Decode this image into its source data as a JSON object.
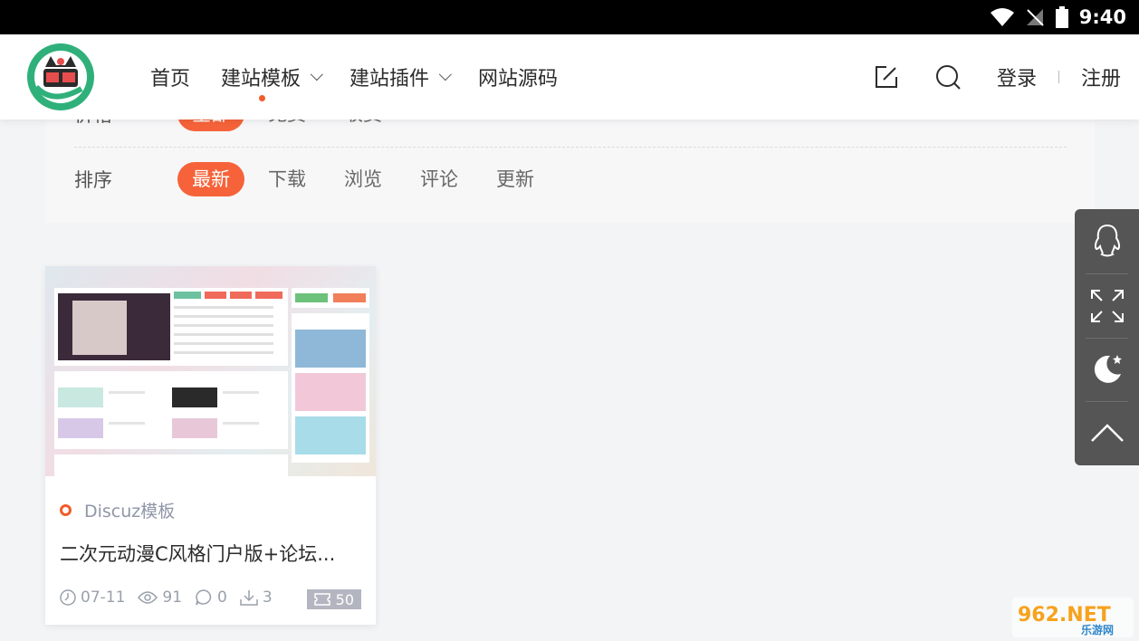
{
  "status_bar": {
    "time": "9:40"
  },
  "nav": {
    "items": [
      {
        "label": "首页"
      },
      {
        "label": "建站模板"
      },
      {
        "label": "建站插件"
      },
      {
        "label": "网站源码"
      }
    ]
  },
  "header": {
    "login": "登录",
    "register": "注册"
  },
  "filter": {
    "sort_label": "排序",
    "sort_options": [
      "最新",
      "下载",
      "浏览",
      "评论",
      "更新"
    ],
    "price_label": "价格",
    "price_options": [
      "全部",
      "免费",
      "收费"
    ]
  },
  "card": {
    "category": "Discuz模板",
    "title": "二次元动漫C风格门户版+论坛...",
    "date": "07-11",
    "views": "91",
    "comments": "0",
    "downloads": "3",
    "price": "50"
  },
  "watermark": {
    "text": "962.NET",
    "subtext": "乐游网"
  },
  "colors": {
    "accent": "#f6633a",
    "float_bg": "#555555"
  }
}
